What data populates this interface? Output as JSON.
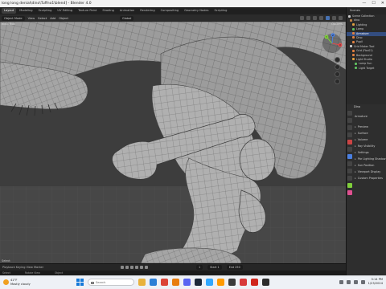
{
  "window": {
    "title": "Blender [D:\\long long denial\\dino\\Tuffno1\\blend] - Blender 4.0",
    "title_display": "long long denial\\dino\\Tuffno1\\blend] - Blender 4.0",
    "minimize": "—",
    "maximize": "☐",
    "close": "✕"
  },
  "tabs": [
    "Layout",
    "Modeling",
    "Sculpting",
    "UV Editing",
    "Texture Paint",
    "Shading",
    "Animation",
    "Rendering",
    "Compositing",
    "Geometry Nodes",
    "Scripting"
  ],
  "active_tab": "Layout",
  "viewport_header": {
    "mode": "Object Mode",
    "view": "View",
    "select": "Select",
    "add": "Add",
    "object": "Object",
    "pivot": "Global",
    "overlay_text": "elect Box",
    "options": "Options"
  },
  "gizmo": {
    "x": "X",
    "y": "Y",
    "z": "Z"
  },
  "viewport_footer": "Select",
  "timeline": {
    "left": "Playback  Keying  View  Marker",
    "start_label": "Start",
    "start": "1",
    "end_label": "End",
    "end": "250",
    "current": "1"
  },
  "statusbar": [
    "Select",
    "Rotate View",
    "Object"
  ],
  "outliner": {
    "header": "Scenes",
    "rows": [
      {
        "label": "Scene Collection",
        "color": "#cccccc",
        "selected": false
      },
      {
        "label": "dino",
        "color": "#c08040",
        "selected": false
      },
      {
        "label": "Lighting",
        "color": "#e0a040",
        "selected": false
      },
      {
        "label": "Lamp",
        "color": "#60c060",
        "selected": false
      },
      {
        "label": "Armature",
        "color": "#e08040",
        "selected": true
      },
      {
        "label": "Dino",
        "color": "#e08040",
        "selected": false
      },
      {
        "label": "Pupil",
        "color": "#e08040",
        "selected": false
      },
      {
        "label": "Grid Maker Tool",
        "color": "#cccccc",
        "selected": false
      },
      {
        "label": "Grid (Fbx01)",
        "color": "#e08040",
        "selected": false
      },
      {
        "label": "Background",
        "color": "#e08040",
        "selected": false
      },
      {
        "label": "Light Studio",
        "color": "#e0a040",
        "selected": false
      },
      {
        "label": "Lamp Sun",
        "color": "#60c060",
        "selected": false
      },
      {
        "label": "Light Target",
        "color": "#60c060",
        "selected": false
      }
    ]
  },
  "properties": {
    "header": "Armature",
    "search": "Search",
    "object": "Dino",
    "rows": [
      "Preview",
      "Surface",
      "Volume",
      "Ray Visibility",
      "Settings",
      "Pbr Lighting Shadow",
      "Sun Position",
      "Viewport Display",
      "Custom Properties"
    ]
  },
  "taskbar": {
    "temperature": "41°F",
    "weather": "Mostly cloudy",
    "search_placeholder": "Search",
    "time": "3:14 PM",
    "date": "1/23/2024",
    "apps": [
      {
        "name": "file-explorer-icon",
        "color": "#e8b23c"
      },
      {
        "name": "edge-icon",
        "color": "#2b7fd6"
      },
      {
        "name": "chrome-icon",
        "color": "#db4437"
      },
      {
        "name": "blender-icon",
        "color": "#e87d0d"
      },
      {
        "name": "discord-icon",
        "color": "#5865f2"
      },
      {
        "name": "steam-icon",
        "color": "#1b2838"
      },
      {
        "name": "photoshop-icon",
        "color": "#31a8ff"
      },
      {
        "name": "illustrator-icon",
        "color": "#ff9a00"
      },
      {
        "name": "zbrush-icon",
        "color": "#3a3a3a"
      },
      {
        "name": "substance-icon",
        "color": "#d83a3a"
      },
      {
        "name": "acrobat-icon",
        "color": "#d0261c"
      },
      {
        "name": "terminal-icon",
        "color": "#2c2c2c"
      }
    ]
  }
}
